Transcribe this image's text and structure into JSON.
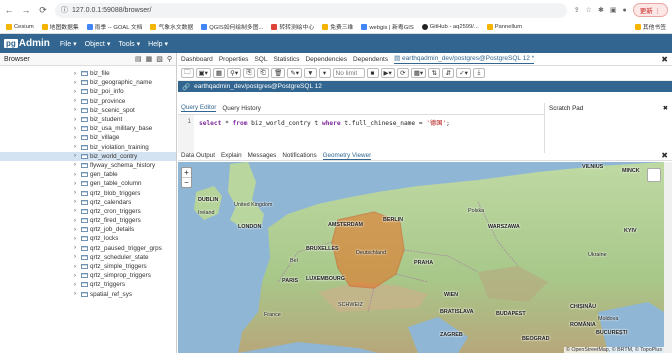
{
  "browser": {
    "back": "←",
    "forward": "→",
    "reload": "⟳",
    "url": "127.0.0.1:59088/browser/",
    "update_label": "更新 ⋮",
    "bookmarks": [
      "Cesium",
      "地图数据集",
      "雨季 -- GOAL 文档",
      "气象水文数据",
      "QGIS如何绘制多图...",
      "转转测绘中心",
      "免费三维",
      "webgis | 新粤GIS",
      "GitHub - aq2599/...",
      "Pannellum",
      "其他书签"
    ]
  },
  "pgadmin": {
    "logo_pg": "pg",
    "logo_text": "Admin",
    "menus": [
      "File ▾",
      "Object ▾",
      "Tools ▾",
      "Help ▾"
    ]
  },
  "left_panel": {
    "title": "Browser",
    "items": [
      "biz_file",
      "biz_geographic_name",
      "biz_poi_info",
      "biz_province",
      "biz_scenic_spot",
      "biz_student",
      "biz_usa_military_base",
      "biz_village",
      "biz_violation_training",
      "biz_world_contry",
      "flyway_schema_history",
      "gen_table",
      "gen_table_column",
      "qrtz_blob_triggers",
      "qrtz_calendars",
      "qrtz_cron_triggers",
      "qrtz_fired_triggers",
      "qrtz_job_details",
      "qrtz_locks",
      "qrtz_paused_trigger_grps",
      "qrtz_scheduler_state",
      "qrtz_simple_triggers",
      "qrtz_simprop_triggers",
      "qrtz_triggers",
      "spatial_ref_sys"
    ],
    "selected_item": "biz_world_contry"
  },
  "main": {
    "tabs": [
      "Dashboard",
      "Properties",
      "SQL",
      "Statistics",
      "Dependencies",
      "Dependents",
      "earthqadmin_dev/postgres@PostgreSQL 12 *"
    ],
    "connection": "earthqadmin_dev/postgres@PostgreSQL 12",
    "no_limit": "No limit",
    "query_tabs": [
      "Query Editor",
      "Query History"
    ],
    "scratch_pad": "Scratch Pad",
    "line_number": "1",
    "sql": {
      "kw1": "select",
      "mid1": " * ",
      "kw2": "from",
      "mid2": " biz_world_contry t ",
      "kw3": "where",
      "mid3": " t.full_chinese_name = ",
      "str": "'德国'",
      "end": ";"
    },
    "result_tabs": [
      "Data Output",
      "Explain",
      "Messages",
      "Notifications",
      "Geometry Viewer"
    ],
    "attribution": "© OpenStreetMap, © BRTM, © TopoPlus"
  },
  "map_labels": [
    {
      "text": "VILNIUS",
      "small": false
    },
    {
      "text": "MINCK",
      "small": false
    },
    {
      "text": "DUBLIN",
      "small": false
    },
    {
      "text": "LONDON",
      "small": false
    },
    {
      "text": "AMSTERDAM",
      "small": false
    },
    {
      "text": "BERLIN",
      "small": false
    },
    {
      "text": "WARSZAWA",
      "small": false
    },
    {
      "text": "KYIV",
      "small": false
    },
    {
      "text": "BRUXELLES",
      "small": false
    },
    {
      "text": "PRAHA",
      "small": false
    },
    {
      "text": "LUXEMBOURG",
      "small": false
    },
    {
      "text": "PARIS",
      "small": false
    },
    {
      "text": "WIEN",
      "small": false
    },
    {
      "text": "BRATISLAVA",
      "small": false
    },
    {
      "text": "BUDAPEST",
      "small": false
    },
    {
      "text": "CHIȘINĂU",
      "small": false
    },
    {
      "text": "ZAGREB",
      "small": false
    },
    {
      "text": "BEOGRAD",
      "small": false
    },
    {
      "text": "BUCUREȘTI",
      "small": false
    },
    {
      "text": "ROMÂNIA",
      "small": false
    },
    {
      "text": "SCHWEIZ",
      "small": true
    },
    {
      "text": "Deutschland",
      "small": true
    },
    {
      "text": "Polska",
      "small": true
    },
    {
      "text": "France",
      "small": true
    },
    {
      "text": "United Kingdom",
      "small": true
    },
    {
      "text": "Ireland",
      "small": true
    },
    {
      "text": "Bel",
      "small": true
    },
    {
      "text": "Ukraine",
      "small": true
    },
    {
      "text": "Moldova",
      "small": true
    }
  ]
}
